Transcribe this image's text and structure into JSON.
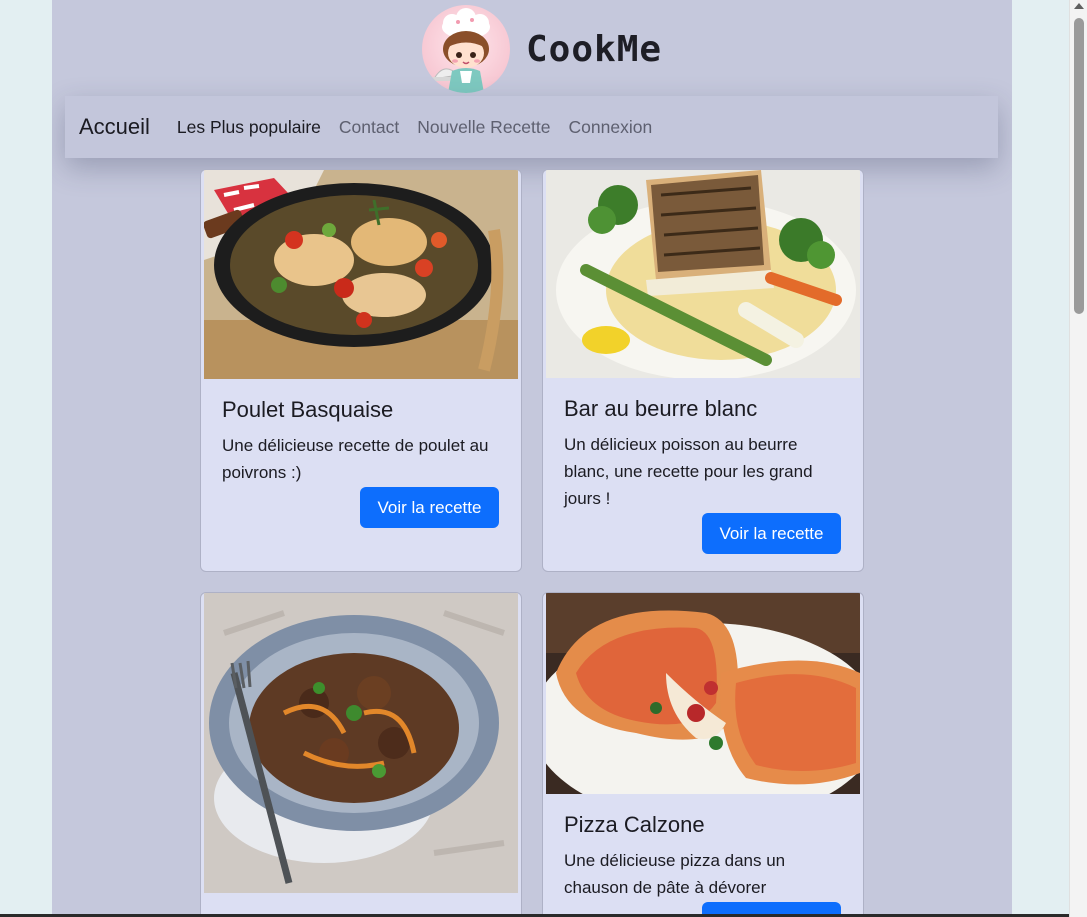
{
  "brand": {
    "name": "CookMe",
    "logo_icon": "chef-girl-logo-icon"
  },
  "navbar": {
    "brand": "Accueil",
    "links": [
      {
        "label": "Les Plus populaire",
        "active": true
      },
      {
        "label": "Contact",
        "active": false
      },
      {
        "label": "Nouvelle Recette",
        "active": false
      },
      {
        "label": "Connexion",
        "active": false
      }
    ]
  },
  "recipes": [
    {
      "title": "Poulet Basquaise",
      "description": "Une délicieuse recette de poulet au poivrons :)",
      "button": "Voir la recette",
      "image_icon": "poulet-basquaise-photo"
    },
    {
      "title": "Bar au beurre blanc",
      "description": "Un délicieux poisson au beurre blanc, une recette pour les grand jours !",
      "button": "Voir la recette",
      "image_icon": "bar-beurre-blanc-photo"
    },
    {
      "title": "",
      "description": "",
      "button": "",
      "image_icon": "beef-stew-photo"
    },
    {
      "title": "Pizza Calzone",
      "description": "Une délicieuse pizza dans un chauson de pâte à dévorer",
      "button": "",
      "image_icon": "pizza-calzone-photo"
    }
  ],
  "colors": {
    "page_bg": "#c5c8dc",
    "card_bg": "#dcdff3",
    "button": "#0d6efd",
    "outer_bg": "#e3eff2"
  }
}
